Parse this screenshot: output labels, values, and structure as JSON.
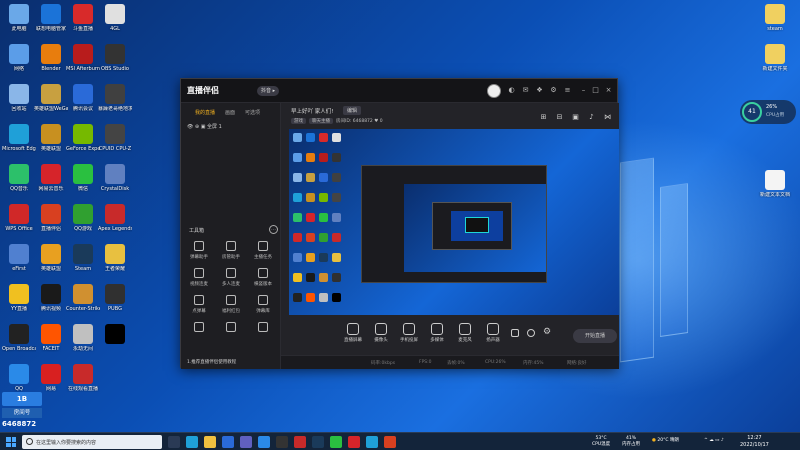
{
  "desktop": {
    "icons_left": [
      {
        "label": "此电脑",
        "color": "#6aa8e8"
      },
      {
        "label": "联想电脑管家",
        "color": "#1b73d8"
      },
      {
        "label": "斗鱼直播",
        "color": "#d82a2a"
      },
      {
        "label": "4GL",
        "color": "#e0e0e0"
      },
      {
        "label": "网络",
        "color": "#5b9de8"
      },
      {
        "label": "Blender",
        "color": "#e87d0d"
      },
      {
        "label": "MSI Afterburner",
        "color": "#b81c1c"
      },
      {
        "label": "OBS Studio",
        "color": "#333"
      },
      {
        "label": "回收站",
        "color": "#8ab6e8"
      },
      {
        "label": "英雄联盟WeGame版",
        "color": "#c8a040"
      },
      {
        "label": "腾讯会议",
        "color": "#2a6ad8"
      },
      {
        "label": "暴躁老哥绝地求生",
        "color": "#404040"
      },
      {
        "label": "Microsoft Edge",
        "color": "#1fa0d8"
      },
      {
        "label": "英雄联盟",
        "color": "#c89020"
      },
      {
        "label": "GeForce Experience",
        "color": "#76b900"
      },
      {
        "label": "CPUID CPU-Z",
        "color": "#444"
      },
      {
        "label": "QQ音乐",
        "color": "#2cc06a"
      },
      {
        "label": "网易云音乐",
        "color": "#d6242a"
      },
      {
        "label": "微信",
        "color": "#2ac040"
      },
      {
        "label": "CrystalDisk",
        "color": "#6080c0"
      },
      {
        "label": "WPS Office",
        "color": "#d02828"
      },
      {
        "label": "直播伴侣",
        "color": "#d84020"
      },
      {
        "label": "QQ游戏",
        "color": "#30a030"
      },
      {
        "label": "Apex Legends",
        "color": "#c82a2a"
      },
      {
        "label": "eFirst",
        "color": "#5080d0"
      },
      {
        "label": "英雄联盟",
        "color": "#e8a020"
      },
      {
        "label": "Steam",
        "color": "#1a3a5a"
      },
      {
        "label": "王者荣耀",
        "color": "#e8c040"
      },
      {
        "label": "YY直播",
        "color": "#f0c020"
      },
      {
        "label": "腾讯视频",
        "color": "#1a1a1a"
      },
      {
        "label": "Counter-Strike",
        "color": "#d09030"
      },
      {
        "label": "PUBG",
        "color": "#303030"
      },
      {
        "label": "Open Broadcaster",
        "color": "#222"
      },
      {
        "label": "FACEIT",
        "color": "#ff5500"
      },
      {
        "label": "永劫无间",
        "color": "#c0c0c0"
      },
      {
        "label": "",
        "color": "#000"
      },
      {
        "label": "QQ",
        "color": "#2a8ae8"
      },
      {
        "label": "网易",
        "color": "#d82020"
      },
      {
        "label": "在线观看直播",
        "color": "#c82a2a"
      }
    ],
    "icons_right": [
      {
        "label": "steam",
        "color": "#f0d060"
      },
      {
        "label": "新建文件夹",
        "color": "#f0d060"
      },
      {
        "label": "新建文本文档",
        "color": "#f4f4f4"
      }
    ],
    "cpu_widget": {
      "value": "41",
      "pct": "26%",
      "label": "CPU占用"
    },
    "overlay": {
      "top": "1B",
      "mid": "房间号",
      "id": "6468872"
    }
  },
  "app": {
    "logo": "直播伴侣",
    "vip": "抖音 ▸",
    "tabs": [
      "我的直播",
      "画面",
      "可选项"
    ],
    "scene": "全屏 1",
    "tools_title": "工具箱",
    "tools": [
      "弹幕助手",
      "房管助手",
      "主播任务",
      "视频连麦",
      "多人连麦",
      "横竖版本",
      "点弹幕",
      "福利红包",
      "弹幕库",
      "",
      "",
      ""
    ],
    "notice": "1.推荐直播伴侣使用教程",
    "room_title": "早上好吖 家人们!",
    "room_tag": "编辑",
    "meta_tags": [
      "游戏",
      "聊天主播"
    ],
    "room_id": "房间ID: 6468872",
    "viewers": "0",
    "bottom_buttons": [
      "直播屏幕",
      "摄像头",
      "手机投屏",
      "多媒体",
      "麦克风",
      "扬声器"
    ],
    "start_live": "开始直播",
    "status_items": [
      "码率:0kbps",
      "FPS:0",
      "丢帧:0%",
      "CPU:26%",
      "内存:45%",
      "网络:良好"
    ]
  },
  "taskbar": {
    "search_placeholder": "在这里输入你要搜索的内容",
    "temp_cpu": "53°C",
    "cpu_temp_label": "CPU温度",
    "mem": "41%",
    "mem_label": "内存占用",
    "weather": "20°C 晴朗",
    "time": "12:27",
    "date": "2022/10/17"
  }
}
